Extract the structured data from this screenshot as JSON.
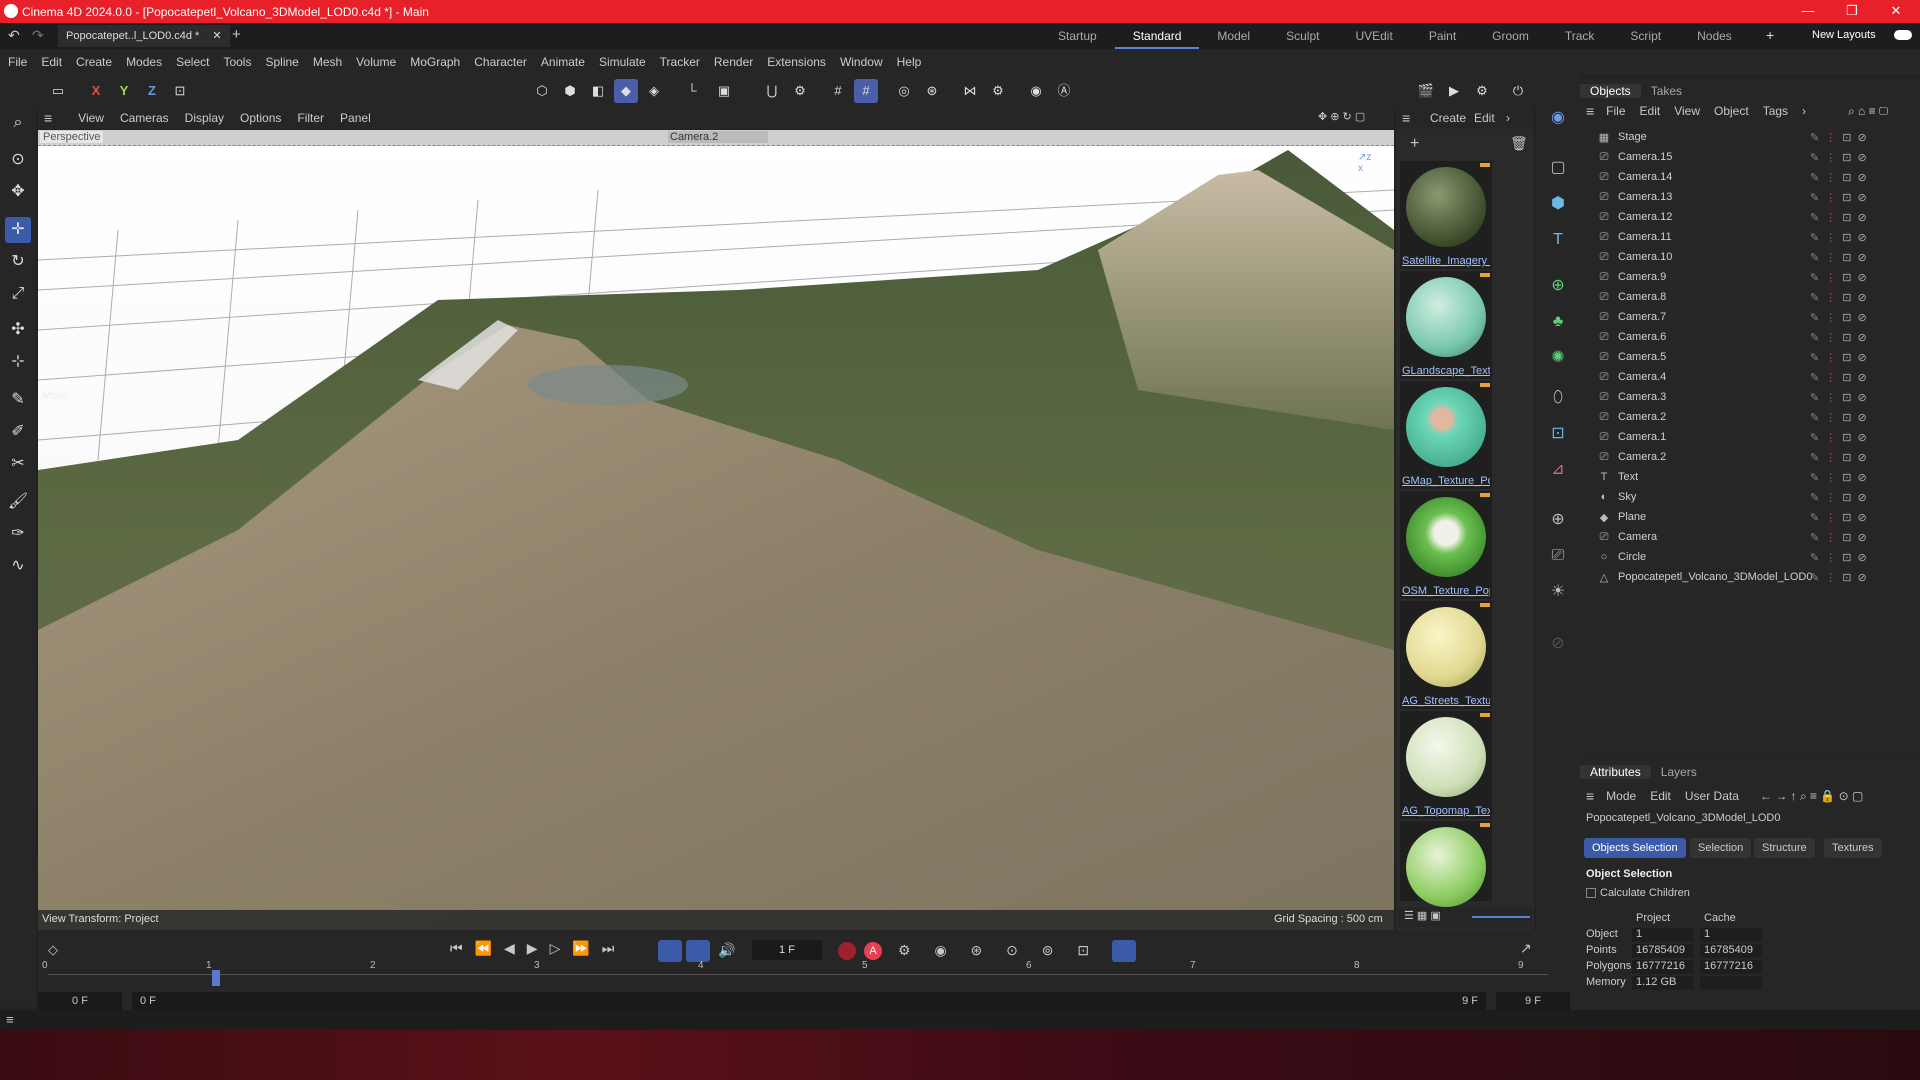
{
  "titlebar": {
    "text": "Cinema 4D 2024.0.0 - [Popocatepetl_Volcano_3DModel_LOD0.c4d *] - Main",
    "minimize": "—",
    "restore": "❐",
    "close": "✕"
  },
  "doc_tab": {
    "label": "Popocatepet..l_LOD0.c4d *",
    "close": "✕"
  },
  "layouts": [
    "Startup",
    "Standard",
    "Model",
    "Sculpt",
    "UVEdit",
    "Paint",
    "Groom",
    "Track",
    "Script",
    "Nodes"
  ],
  "new_layouts": "New Layouts",
  "menu": [
    "File",
    "Edit",
    "Create",
    "Modes",
    "Select",
    "Tools",
    "Spline",
    "Mesh",
    "Volume",
    "MoGraph",
    "Character",
    "Animate",
    "Simulate",
    "Tracker",
    "Render",
    "Extensions",
    "Window",
    "Help"
  ],
  "axes": [
    "X",
    "Y",
    "Z"
  ],
  "viewport": {
    "menu": [
      "View",
      "Cameras",
      "Display",
      "Options",
      "Filter",
      "Panel"
    ],
    "label": "Perspective",
    "camera": "Camera.2",
    "move": "Move",
    "view_transform": "View Transform: Project",
    "grid_spacing": "Grid Spacing : 500 cm"
  },
  "material_panel": {
    "menu": [
      "Create",
      "Edit"
    ],
    "materials": [
      "Satellite_Imagery_",
      "GLandscape_Textu",
      "GMap_Texture_Po",
      "OSM_Texture_Pop",
      "AG_Streets_Textur",
      "AG_Topomap_Text",
      ""
    ]
  },
  "objects_panel": {
    "tabs": [
      "Objects",
      "Takes"
    ],
    "menu": [
      "File",
      "Edit",
      "View",
      "Object",
      "Tags"
    ],
    "items": [
      {
        "name": "Stage",
        "icon": "stage-icon"
      },
      {
        "name": "Camera.15",
        "icon": "camera-icon"
      },
      {
        "name": "Camera.14",
        "icon": "camera-icon"
      },
      {
        "name": "Camera.13",
        "icon": "camera-icon"
      },
      {
        "name": "Camera.12",
        "icon": "camera-icon"
      },
      {
        "name": "Camera.11",
        "icon": "camera-icon"
      },
      {
        "name": "Camera.10",
        "icon": "camera-icon"
      },
      {
        "name": "Camera.9",
        "icon": "camera-icon"
      },
      {
        "name": "Camera.8",
        "icon": "camera-icon"
      },
      {
        "name": "Camera.7",
        "icon": "camera-icon"
      },
      {
        "name": "Camera.6",
        "icon": "camera-icon"
      },
      {
        "name": "Camera.5",
        "icon": "camera-icon"
      },
      {
        "name": "Camera.4",
        "icon": "camera-icon"
      },
      {
        "name": "Camera.3",
        "icon": "camera-icon"
      },
      {
        "name": "Camera.2",
        "icon": "camera-icon"
      },
      {
        "name": "Camera.1",
        "icon": "camera-icon"
      },
      {
        "name": "Camera.2",
        "icon": "camera-icon"
      },
      {
        "name": "Text",
        "icon": "text-icon"
      },
      {
        "name": "Sky",
        "icon": "sky-icon"
      },
      {
        "name": "Plane",
        "icon": "plane-icon"
      },
      {
        "name": "Camera",
        "icon": "camera-icon"
      },
      {
        "name": "Circle",
        "icon": "circle-icon"
      },
      {
        "name": "Popocatepetl_Volcano_3DModel_LOD0",
        "icon": "polygon-object-icon"
      }
    ]
  },
  "attributes": {
    "tabs": [
      "Attributes",
      "Layers"
    ],
    "menu": [
      "Mode",
      "Edit",
      "User Data"
    ],
    "object_name": "Popocatepetl_Volcano_3DModel_LOD0",
    "buttons": [
      "Objects Selection",
      "Selection",
      "Structure",
      "Textures"
    ],
    "section": "Object Selection",
    "calc_children": "Calculate Children",
    "col_project": "Project",
    "col_cache": "Cache",
    "rows": [
      {
        "label": "Object",
        "project": "1",
        "cache": "1"
      },
      {
        "label": "Points",
        "project": "16785409",
        "cache": "16785409"
      },
      {
        "label": "Polygons",
        "project": "16777216",
        "cache": "16777216"
      },
      {
        "label": "Memory",
        "project": "1.12 GB",
        "cache": ""
      }
    ]
  },
  "timeline": {
    "frame": "1 F",
    "start": "0 F",
    "start2": "0 F",
    "end": "9 F",
    "end2": "9 F",
    "ticks": [
      "0",
      "1",
      "2",
      "3",
      "4",
      "5",
      "6",
      "7",
      "8",
      "9"
    ],
    "current_frame": 1
  },
  "colors": {
    "accent": "#3b5ba8",
    "title": "#e8202a"
  }
}
